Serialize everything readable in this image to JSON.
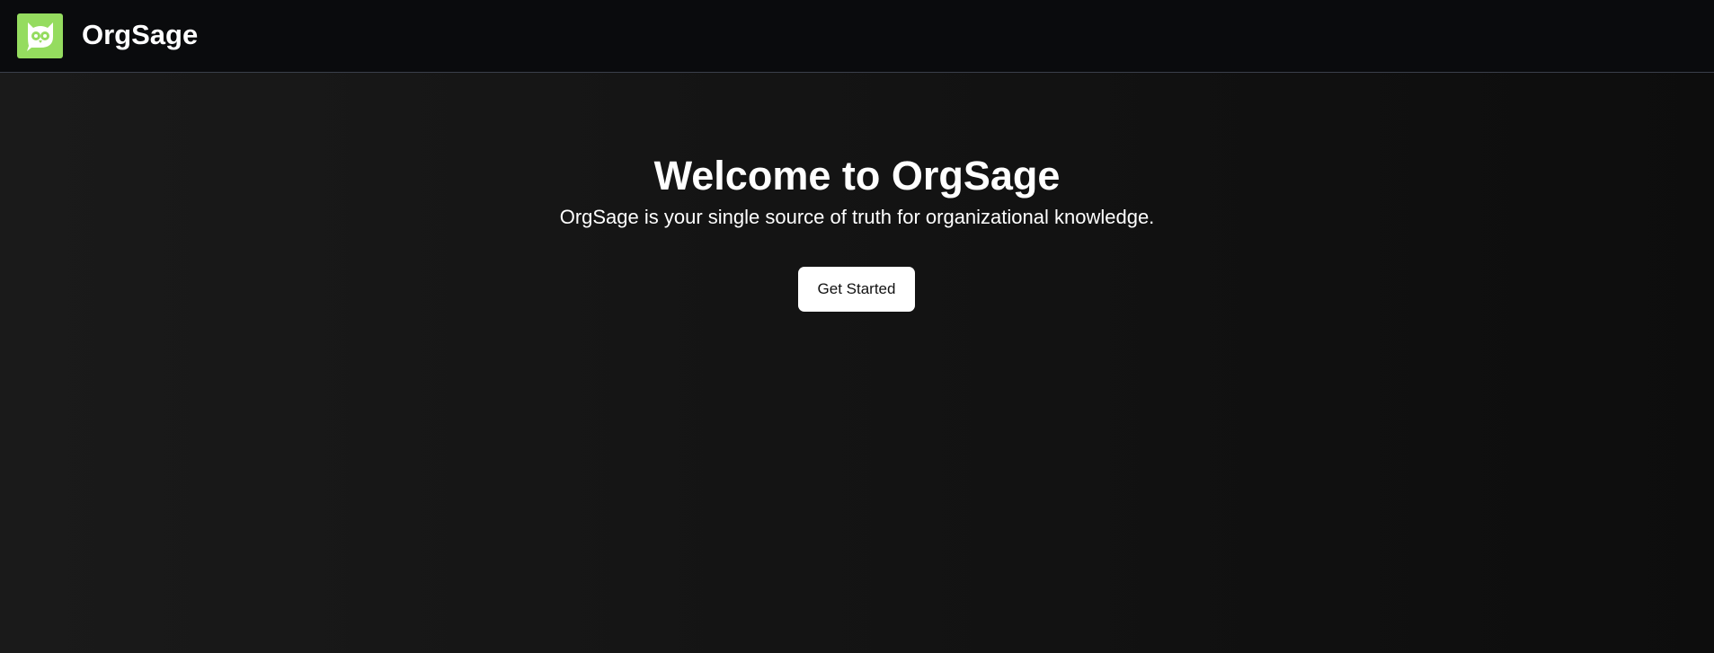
{
  "header": {
    "brand_name": "OrgSage",
    "logo_icon": "owl-icon",
    "logo_color": "#95dc5f"
  },
  "hero": {
    "title": "Welcome to OrgSage",
    "subtitle": "OrgSage is your single source of truth for organizational knowledge.",
    "cta_label": "Get Started"
  }
}
